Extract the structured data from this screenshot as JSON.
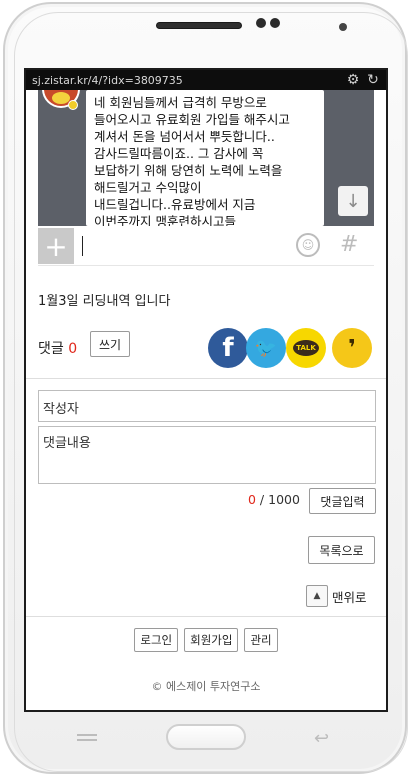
{
  "browser": {
    "url": "sj.zistar.kr/4/?idx=3809735",
    "settings_icon": "gear-icon",
    "reload_icon": "reload-icon"
  },
  "chat": {
    "message_lines": [
      "네 회원님들께서 급격히 무방으로",
      "들어오시고 유료회원 가입들 해주시고",
      "계셔서 돈을 넘어서서 뿌듯합니다..",
      "감사드릴따름이죠.. 그 감사에 꼭",
      "보답하기 위해 당연히 노력에 노력을",
      "해드릴거고 수익많이",
      "내드릴겁니다..유료방에서 지금",
      "이번주까지 맹훈련하시고들"
    ],
    "scroll_icon": "↓",
    "plus_icon": "+",
    "emoji_icon": "☺",
    "hash_icon": "#"
  },
  "post": {
    "title": "1월3일 리딩내역 입니다"
  },
  "comments": {
    "label": "댓글",
    "count": "0",
    "write_label": "쓰기"
  },
  "share": {
    "facebook": "f",
    "twitter": "🐦",
    "kakaotalk": "TALK",
    "kakaostory": "❜"
  },
  "form": {
    "author_placeholder": "작성자",
    "content_placeholder": "댓글내용",
    "counter_current": "0",
    "counter_sep": " / ",
    "counter_max": "1000",
    "submit_label": "댓글입력"
  },
  "nav": {
    "list_label": "목록으로",
    "top_arrow": "▲",
    "top_label": "맨위로"
  },
  "footer": {
    "login": "로그인",
    "signup": "회원가입",
    "admin": "관리",
    "copyright": "© 에스제이 투자연구소"
  },
  "colors": {
    "accent_red": "#e0271b",
    "facebook": "#2f5a9a",
    "twitter": "#34a8e0",
    "kakao": "#f7d700"
  }
}
